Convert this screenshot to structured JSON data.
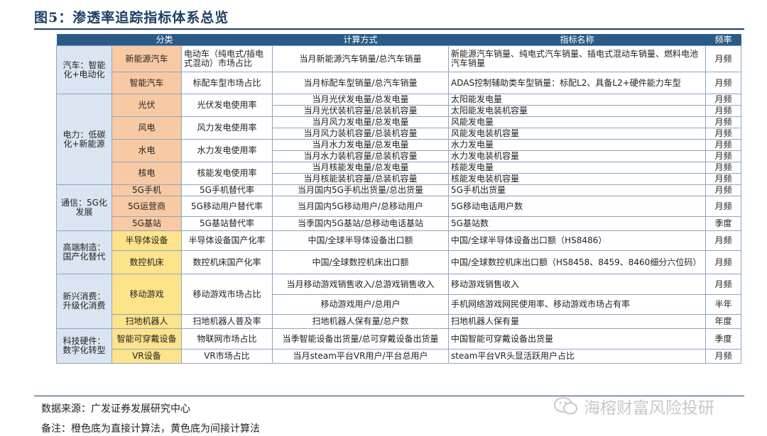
{
  "title": "图5：渗透率追踪指标体系总览",
  "headers": {
    "category": "分类",
    "method": "计算方式",
    "indicator": "指标名称",
    "freq": "频率"
  },
  "cats": {
    "auto": "汽车：智能化+电动化",
    "power": "电力：低碳化+新能源",
    "telecom": "通信：5G化发展",
    "mfg": "高端制造：国产化替代",
    "consume": "新兴消费：升级化消费",
    "tech": "科技硬件：数字化转型"
  },
  "rows": {
    "nev": {
      "sub": "新能源汽车",
      "metric": "电动车（纯电式/插电式混动）市场占比",
      "method": "当月新能源汽车销量/总汽车销量",
      "indicator": "新能源汽车销量、纯电式汽车销量、插电式混动车销量、燃料电池汽车销量",
      "freq": "月频"
    },
    "smartcar": {
      "sub": "智能汽车",
      "metric": "标配车型市场占比",
      "method": "当月标配车型销量/总汽车销量",
      "indicator": "ADAS控制辅助类车型销量：标配L2、具备L2+硬件能力车型",
      "freq": "月频"
    },
    "pv": {
      "sub": "光伏",
      "metric": "光伏发电使用率",
      "m1": "当月光伏发电量/总发电量",
      "i1": "太阳能发电量",
      "f1": "月频",
      "m2": "当月光伏装机容量/总装机容量",
      "i2": "太阳能发电装机容量",
      "f2": "月频"
    },
    "wind": {
      "sub": "风电",
      "metric": "风力发电使用率",
      "m1": "当月风力发电量/总发电量",
      "i1": "风能发电量",
      "f1": "月频",
      "m2": "当月风力装机容量/总装机容量",
      "i2": "风能发电装机容量",
      "f2": "月频"
    },
    "hydro": {
      "sub": "水电",
      "metric": "水力发电使用率",
      "m1": "当月水力发电量/总发电量",
      "i1": "水力发电量",
      "f1": "月频",
      "m2": "当月水力装机容量/总装机容量",
      "i2": "水力发电装机容量",
      "f2": "月频"
    },
    "nuclear": {
      "sub": "核电",
      "metric": "核能发电使用率",
      "m1": "当月核能发电量/总发电量",
      "i1": "核能发电量",
      "f1": "月频",
      "m2": "当月核能装机容量/总装机容量",
      "i2": "核能发电装机容量",
      "f2": "月频"
    },
    "phone5g": {
      "sub": "5G手机",
      "metric": "5G手机替代率",
      "method": "当月国内5G手机出货量/总出货量",
      "indicator": "5G手机出货量",
      "freq": "月频"
    },
    "op5g": {
      "sub": "5G运营商",
      "metric": "5G移动用户替代率",
      "method": "当月国内5G移动用户/总移动用户",
      "indicator": "5G移动电话用户数",
      "freq": "月频"
    },
    "bs5g": {
      "sub": "5G基站",
      "metric": "5G基站替代率",
      "method": "当季国内5G基站/总移动电话基站",
      "indicator": "5G基站数",
      "freq": "季度"
    },
    "semi": {
      "sub": "半导体设备",
      "metric": "半导体设备国产化率",
      "method": "中国/全球半导体设备出口额",
      "indicator": "中国/全球半导体设备出口额（HS8486）",
      "freq": "月频"
    },
    "cnc": {
      "sub": "数控机床",
      "metric": "数控机床国产化率",
      "method": "中国/全球数控机床出口额",
      "indicator": "中国/全球数控机床出口额（HS8458、8459、8460细分六位码）",
      "freq": "月频"
    },
    "game": {
      "sub": "移动游戏",
      "metric": "移动游戏市场占比",
      "m1": "当月移动游戏销售收入/总游戏销售收入",
      "i1": "移动游戏销售收入",
      "f1": "月频",
      "m2": "移动游戏用户/总用户",
      "i2": "手机网络游戏网民使用率、移动游戏市场占有率",
      "f2": "半年"
    },
    "robot": {
      "sub": "扫地机器人",
      "metric": "扫地机器人普及率",
      "method": "扫地机器人保有量/总户数",
      "indicator": "扫地机器人保有量",
      "freq": "年度"
    },
    "wear": {
      "sub": "智能可穿戴设备",
      "metric": "物联网市场占比",
      "method": "当季智能设备出货量/总可穿戴设备出货量",
      "indicator": "中国智能可穿戴设备出货量",
      "freq": "季度"
    },
    "vr": {
      "sub": "VR设备",
      "metric": "VR市场占比",
      "method": "当月steam平台VR用户/平台总用户",
      "indicator": "steam平台VR头显活跃用户占比",
      "freq": "月频"
    }
  },
  "source": "数据来源：广发证券发展研究中心",
  "note": "备注：橙色底为直接计算法，黄色底为间接计算法",
  "logo_text": "海榕财富风险投研"
}
